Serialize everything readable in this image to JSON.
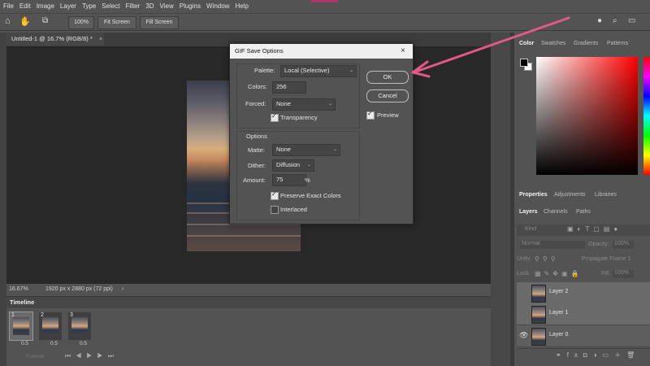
{
  "menu": [
    "File",
    "Edit",
    "Image",
    "Layer",
    "Type",
    "Select",
    "Filter",
    "3D",
    "View",
    "Plugins",
    "Window",
    "Help"
  ],
  "options": {
    "zoom": "100%",
    "fit_screen": "Fit Screen",
    "fill_screen": "Fill Screen"
  },
  "document": {
    "tab": "Untitled-1 @ 16.7% (RGB/8) *",
    "zoom": "16.67%",
    "size": "1920 px x 2880 px (72 ppi)"
  },
  "timeline": {
    "title": "Timeline",
    "frames": [
      {
        "num": "1",
        "delay": "0.5"
      },
      {
        "num": "2",
        "delay": "0.5"
      },
      {
        "num": "3",
        "delay": "0.5"
      }
    ],
    "loop": "Forever"
  },
  "panels": {
    "color_tabs": [
      "Color",
      "Swatches",
      "Gradients",
      "Patterns"
    ],
    "prop_tabs": [
      "Properties",
      "Adjustments",
      "Libraries"
    ],
    "layer_tabs": [
      "Layers",
      "Channels",
      "Paths"
    ],
    "kind": "Kind",
    "blend": "Normal",
    "opacity_label": "Opacity:",
    "opacity": "100%",
    "unify": "Unify:",
    "propagate": "Propagate Frame 1",
    "lock": "Lock:",
    "fill_label": "Fill:",
    "fill": "100%",
    "layers": [
      "Layer 2",
      "Layer 1",
      "Layer 0"
    ]
  },
  "dialog": {
    "title": "GIF Save Options",
    "palette_label": "Palette:",
    "palette": "Local (Selective)",
    "colors_label": "Colors:",
    "colors": "256",
    "forced_label": "Forced:",
    "forced": "None",
    "transparency": "Transparency",
    "options_label": "Options",
    "matte_label": "Matte:",
    "matte": "None",
    "dither_label": "Dither:",
    "dither": "Diffusion",
    "amount_label": "Amount:",
    "amount": "75",
    "amount_unit": "%",
    "preserve": "Preserve Exact Colors",
    "interlaced": "Interlaced",
    "ok": "OK",
    "cancel": "Cancel",
    "preview": "Preview"
  },
  "colors": {
    "accent": "#e05a86",
    "dialog_bg": "#535353"
  }
}
